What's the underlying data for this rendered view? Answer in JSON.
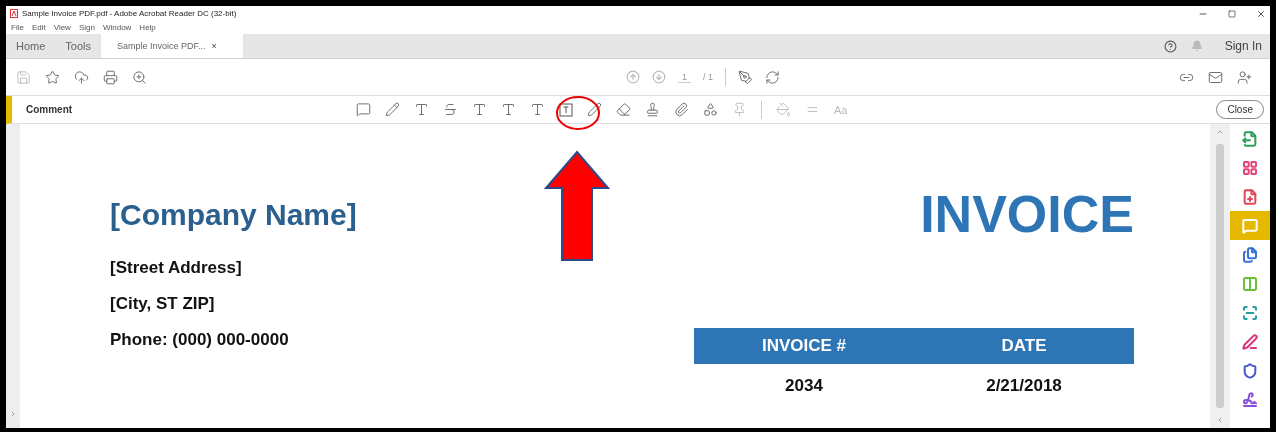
{
  "window": {
    "title": "Sample Invoice PDF.pdf - Adobe Acrobat Reader DC (32-bit)"
  },
  "menu": [
    "File",
    "Edit",
    "View",
    "Sign",
    "Window",
    "Help"
  ],
  "tabs": [
    {
      "label": "Home",
      "selected": false
    },
    {
      "label": "Tools",
      "selected": false
    },
    {
      "label": "Sample Invoice PDF...",
      "selected": true,
      "close": "×"
    }
  ],
  "account": {
    "sign_in": "Sign In"
  },
  "page_nav": {
    "current": "1",
    "total": "/ 1"
  },
  "comment_bar": {
    "label": "Comment",
    "font_tool": "Aa",
    "close": "Close"
  },
  "right_tools": [
    {
      "kind": "export",
      "color": "#2e9e5b",
      "selected": false
    },
    {
      "kind": "organize",
      "color": "#e0457b",
      "selected": false
    },
    {
      "kind": "create",
      "color": "#e0455a",
      "selected": false
    },
    {
      "kind": "comment",
      "color": "#ffffff",
      "selected": true
    },
    {
      "kind": "combine",
      "color": "#3a6fd8",
      "selected": false
    },
    {
      "kind": "compare",
      "color": "#6cbf3a",
      "selected": false
    },
    {
      "kind": "scan",
      "color": "#1f9e9e",
      "selected": false
    },
    {
      "kind": "sign",
      "color": "#d8357b",
      "selected": false
    },
    {
      "kind": "protect",
      "color": "#4a55c9",
      "selected": false
    },
    {
      "kind": "fill",
      "color": "#8a4fd8",
      "selected": false
    }
  ],
  "document": {
    "company": "[Company Name]",
    "address": [
      "[Street Address]",
      "[City, ST  ZIP]",
      "Phone: (000) 000-0000"
    ],
    "title": "INVOICE",
    "table": {
      "columns": [
        "INVOICE #",
        "DATE"
      ],
      "rows": [
        [
          "2034",
          "2/21/2018"
        ]
      ]
    }
  }
}
